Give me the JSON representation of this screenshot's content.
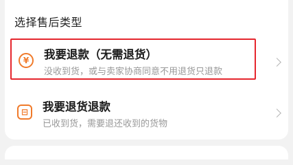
{
  "section": {
    "title": "选择售后类型"
  },
  "options": [
    {
      "icon": "yuan-circle-icon",
      "icon_glyph": "¥",
      "title": "我要退款（无需退货）",
      "subtitle": "没收到货，或与卖家协商同意不用退货只退款"
    },
    {
      "icon": "package-return-icon",
      "icon_glyph": "⊟",
      "title": "我要退货退款",
      "subtitle": "已收到货，需要退还收到的货物"
    }
  ],
  "colors": {
    "accent": "#f07a2a",
    "highlight_border": "#e5252d",
    "background": "#f2f2f2"
  }
}
